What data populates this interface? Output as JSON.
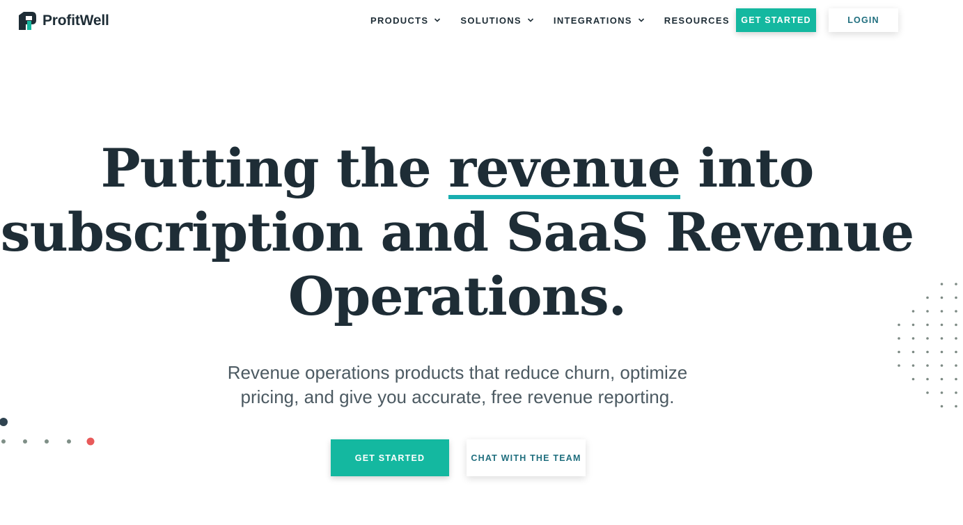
{
  "brand": {
    "name": "ProfitWell",
    "accent": "#14b8a0",
    "underline": "#19aeb0",
    "dark": "#1e2d36",
    "dot_red": "#e85a5a"
  },
  "nav": {
    "items": [
      {
        "label": "PRODUCTS",
        "icon": "chevron-down-icon"
      },
      {
        "label": "SOLUTIONS",
        "icon": "chevron-down-icon"
      },
      {
        "label": "INTEGRATIONS",
        "icon": "chevron-down-icon"
      },
      {
        "label": "RESOURCES",
        "icon": "chevron-down-icon"
      }
    ],
    "get_started_label": "GET STARTED",
    "login_label": "LOGIN"
  },
  "hero": {
    "headline_part1": "Putting the ",
    "headline_highlight": "revenue",
    "headline_part2": " into subscription and SaaS Revenue Operations.",
    "subtitle": "Revenue operations products that reduce churn, optimize pricing, and give you accurate, free revenue reporting.",
    "primary_cta": "GET STARTED",
    "secondary_cta": "CHAT WITH THE TEAM"
  }
}
